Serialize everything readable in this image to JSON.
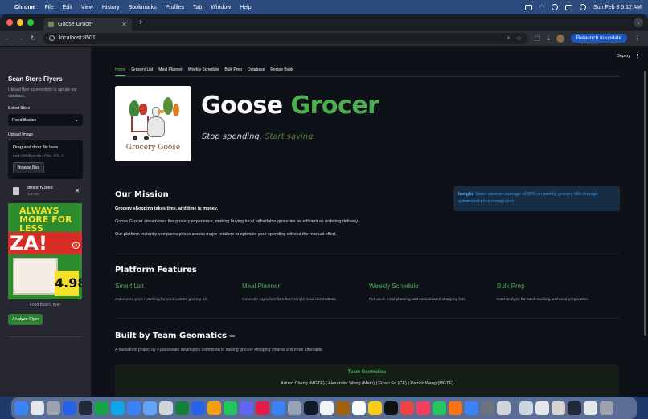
{
  "menubar": {
    "items": [
      "Chrome",
      "File",
      "Edit",
      "View",
      "History",
      "Bookmarks",
      "Profiles",
      "Tab",
      "Window",
      "Help"
    ],
    "datetime": "Sun Feb 8  5:12 AM"
  },
  "browser": {
    "tab_title": "Goose Grocer",
    "url": "localhost:8501",
    "relaunch_label": "Relaunch to update"
  },
  "sidebar": {
    "title": "Scan Store Flyers",
    "subtitle": "Upload flyer screenshots to update our database.",
    "store_label": "Select Store",
    "store_value": "Food Basics",
    "upload_label": "Upload Image",
    "dropzone_title": "Drag and drop file here",
    "dropzone_limit": "Limit 200MB per file • PNG, JPG, J...",
    "browse_label": "Browse files",
    "file_name": "grocerry.jpeg",
    "file_size": "114.4KB",
    "flyer_caption": "Food Basics flyer",
    "flyer_text_top": "ALWAYS MORE FOR LESS",
    "flyer_text_za": "ZA!",
    "flyer_price": "4.98",
    "analyze_label": "Analyze Flyer"
  },
  "app": {
    "deploy_label": "Deploy",
    "tabs": [
      "Home",
      "Grocery List",
      "Meal Planner",
      "Weekly Schedule",
      "Bulk Prep",
      "Database",
      "Recipe Book"
    ],
    "logo_text": "Grocery Goose",
    "title_part1": "Goose",
    "title_part2": "Grocer",
    "tagline_part1": "Stop spending.",
    "tagline_part2": "Start saving.",
    "mission": {
      "heading": "Our Mission",
      "line1": "Grocery shopping takes time, and time is money.",
      "line2": "Goose Grocer streamlines the grocery experience, making buying local, affordable groceries as efficient as ordering delivery.",
      "line3": "Our platform instantly compares prices across major retailers to optimize your spending without the manual effort."
    },
    "insight": {
      "label": "Insight:",
      "text": "Users save an average of 30% on weekly grocery bills through automated price comparison."
    },
    "features": {
      "heading": "Platform Features",
      "items": [
        {
          "title": "Smart List",
          "desc": "Automated price matching for your custom grocery list."
        },
        {
          "title": "Meal Planner",
          "desc": "Generate ingredient lists from simple meal descriptions."
        },
        {
          "title": "Weekly Schedule",
          "desc": "Full-week meal planning and consolidated shopping lists."
        },
        {
          "title": "Bulk Prep",
          "desc": "Cost analysis for batch cooking and meal preparation."
        }
      ]
    },
    "team": {
      "heading": "Built by Team Geomatics",
      "desc": "A hackathon project by 4 passionate developers committed to making grocery shopping smarter and more affordable.",
      "box_title": "Team Geomatics",
      "members": "Adrien Cheng (MGTE) | Alexander Wong (Math) | Ethan So (CE) | Patrick Wang (MGTE)"
    }
  },
  "colors": {
    "accent_green": "#4caf50",
    "background": "#0e1117",
    "sidebar": "#262730",
    "insight_bg": "#172d43"
  }
}
